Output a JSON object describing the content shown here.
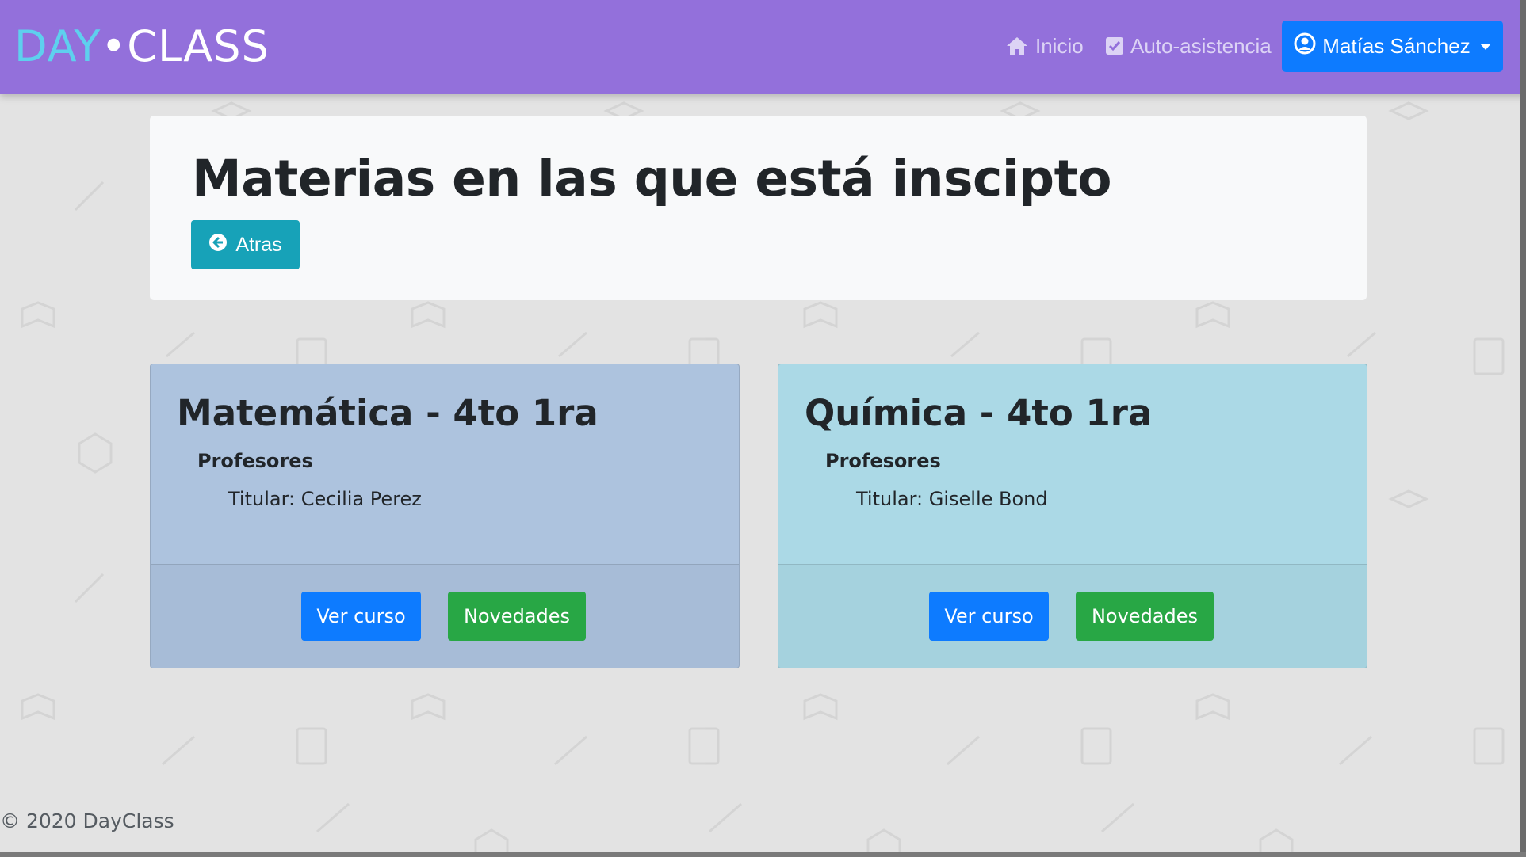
{
  "navbar": {
    "brand_day": "DAY",
    "brand_dot": "•",
    "brand_class": "CLASS",
    "home_label": "Inicio",
    "auto_label": "Auto-asistencia",
    "user_label": "Matías Sánchez",
    "color": "#9370db",
    "brand_accent": "#5ed0ee"
  },
  "header": {
    "title": "Materias en las que está inscipto",
    "back_label": "Atras"
  },
  "courses": [
    {
      "title": "Matemática - 4to 1ra",
      "professors_heading": "Profesores",
      "professor": "Titular: Cecilia Perez",
      "view_label": "Ver curso",
      "news_label": "Novedades",
      "color": "#adc3de"
    },
    {
      "title": "Química - 4to 1ra",
      "professors_heading": "Profesores",
      "professor": "Titular: Giselle Bond",
      "view_label": "Ver curso",
      "news_label": "Novedades",
      "color": "#abd9e6"
    }
  ],
  "footer": {
    "copyright": "© 2020 DayClass"
  },
  "icons": {
    "home": "home-icon",
    "checkbox": "check-square-icon",
    "user": "user-circle-icon",
    "back": "arrow-circle-left-icon"
  }
}
